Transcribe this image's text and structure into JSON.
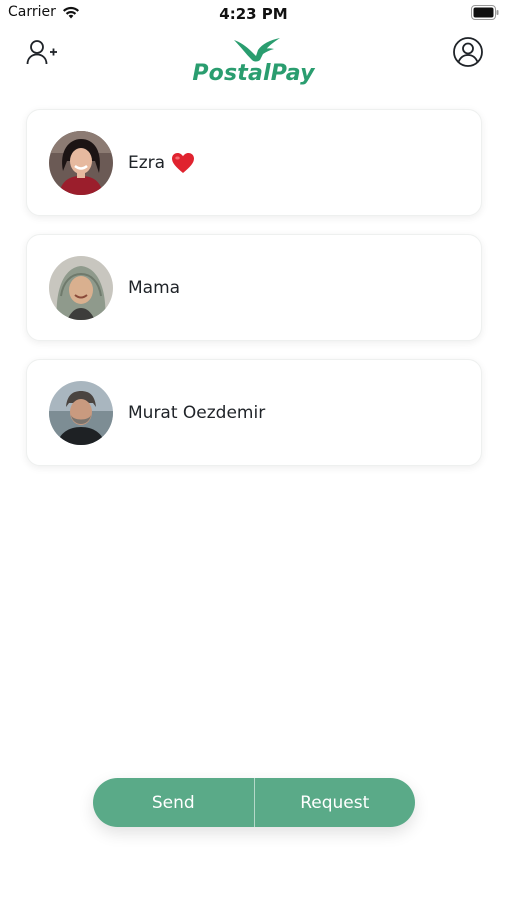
{
  "status_bar": {
    "carrier": "Carrier",
    "time": "4:23 PM"
  },
  "header": {
    "app_name": "PostalPay",
    "brand_color": "#2a9d6f"
  },
  "contacts": [
    {
      "name": "Ezra",
      "emoji": "heart",
      "avatar": "woman-dark-hair"
    },
    {
      "name": "Mama",
      "avatar": "woman-headscarf"
    },
    {
      "name": "Murat Oezdemir",
      "avatar": "man-grey-beard"
    }
  ],
  "actions": {
    "send_label": "Send",
    "request_label": "Request",
    "button_color": "#5aaa88"
  }
}
